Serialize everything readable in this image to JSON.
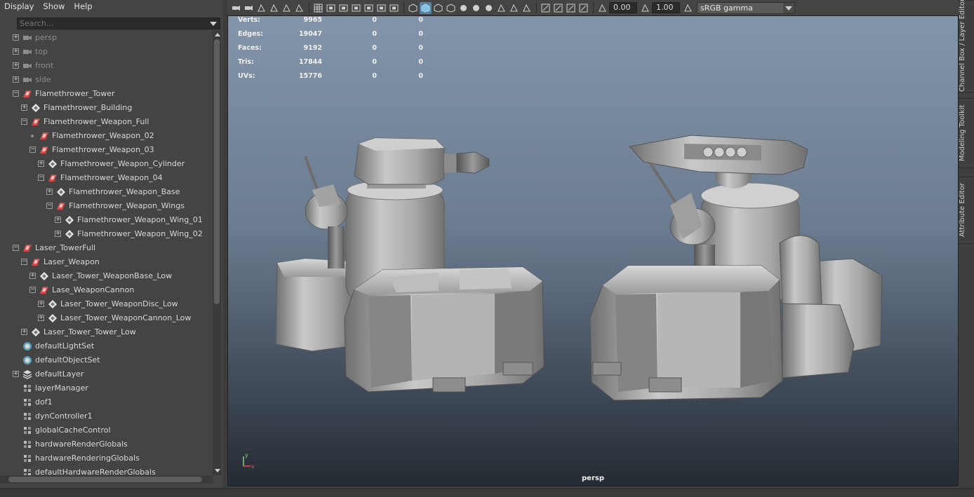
{
  "menu": [
    "Display",
    "Show",
    "Help"
  ],
  "search": {
    "placeholder": "Search..."
  },
  "outliner": [
    {
      "label": "persp",
      "type": "camera",
      "depth": 0,
      "expander": "plus",
      "dim": true
    },
    {
      "label": "top",
      "type": "camera",
      "depth": 0,
      "expander": "plus",
      "dim": true
    },
    {
      "label": "front",
      "type": "camera",
      "depth": 0,
      "expander": "plus",
      "dim": true
    },
    {
      "label": "side",
      "type": "camera",
      "depth": 0,
      "expander": "plus",
      "dim": true
    },
    {
      "label": "Flamethrower_Tower",
      "type": "group",
      "depth": 0,
      "expander": "minus"
    },
    {
      "label": "Flamethrower_Building",
      "type": "mesh",
      "depth": 1,
      "expander": "plus"
    },
    {
      "label": "Flamethrower_Weapon_Full",
      "type": "group",
      "depth": 1,
      "expander": "minus"
    },
    {
      "label": "Flamethrower_Weapon_02",
      "type": "group",
      "depth": 2,
      "expander": "dot"
    },
    {
      "label": "Flamethrower_Weapon_03",
      "type": "group",
      "depth": 2,
      "expander": "minus"
    },
    {
      "label": "Flamethrower_Weapon_Cylinder",
      "type": "mesh",
      "depth": 3,
      "expander": "plus"
    },
    {
      "label": "Flamethrower_Weapon_04",
      "type": "group",
      "depth": 3,
      "expander": "minus"
    },
    {
      "label": "Flamethrower_Weapon_Base",
      "type": "mesh",
      "depth": 4,
      "expander": "plus"
    },
    {
      "label": "Flamethrower_Weapon_Wings",
      "type": "group",
      "depth": 4,
      "expander": "minus"
    },
    {
      "label": "Flamethrower_Weapon_Wing_01",
      "type": "mesh",
      "depth": 5,
      "expander": "plus"
    },
    {
      "label": "Flamethrower_Weapon_Wing_02",
      "type": "mesh",
      "depth": 5,
      "expander": "plus"
    },
    {
      "label": "Laser_TowerFull",
      "type": "group",
      "depth": 0,
      "expander": "minus"
    },
    {
      "label": "Laser_Weapon",
      "type": "group",
      "depth": 1,
      "expander": "minus"
    },
    {
      "label": "Laser_Tower_WeaponBase_Low",
      "type": "mesh",
      "depth": 2,
      "expander": "plus"
    },
    {
      "label": "Lase_WeaponCannon",
      "type": "group",
      "depth": 2,
      "expander": "minus"
    },
    {
      "label": "Laser_Tower_WeaponDisc_Low",
      "type": "mesh",
      "depth": 3,
      "expander": "plus"
    },
    {
      "label": "Laser_Tower_WeaponCannon_Low",
      "type": "mesh",
      "depth": 3,
      "expander": "plus"
    },
    {
      "label": "Laser_Tower_Tower_Low",
      "type": "mesh",
      "depth": 1,
      "expander": "plus"
    },
    {
      "label": "defaultLightSet",
      "type": "set",
      "depth": 0,
      "expander": "none"
    },
    {
      "label": "defaultObjectSet",
      "type": "set",
      "depth": 0,
      "expander": "none"
    },
    {
      "label": "defaultLayer",
      "type": "layer",
      "depth": 0,
      "expander": "plus"
    },
    {
      "label": "layerManager",
      "type": "node",
      "depth": 0,
      "expander": "none"
    },
    {
      "label": "dof1",
      "type": "node",
      "depth": 0,
      "expander": "none"
    },
    {
      "label": "dynController1",
      "type": "node",
      "depth": 0,
      "expander": "none"
    },
    {
      "label": "globalCacheControl",
      "type": "node",
      "depth": 0,
      "expander": "none"
    },
    {
      "label": "hardwareRenderGlobals",
      "type": "node",
      "depth": 0,
      "expander": "none"
    },
    {
      "label": "hardwareRenderingGlobals",
      "type": "node",
      "depth": 0,
      "expander": "none"
    },
    {
      "label": "defaultHardwareRenderGlobals",
      "type": "node",
      "depth": 0,
      "expander": "none"
    }
  ],
  "toolbar": {
    "exposure": "0.00",
    "gamma": "1.00",
    "colorspace": "sRGB gamma",
    "icons": [
      "camera-select-icon",
      "camera-attr-icon",
      "bookmark-icon",
      "image-plane-icon",
      "2d-pan-zoom-icon",
      "grease-pencil-icon",
      "grid-icon",
      "film-gate-icon",
      "resolution-gate-icon",
      "gate-mask-icon",
      "field-chart-icon",
      "safe-action-icon",
      "safe-title-icon",
      "wireframe-icon",
      "smooth-shade-icon",
      "wire-on-shaded-icon",
      "textured-icon",
      "use-lights-icon",
      "shadows-icon",
      "ambient-occlusion-icon",
      "motion-blur-icon",
      "anti-alias-icon",
      "dof-icon",
      "isolate-icon",
      "xray-icon",
      "xray-joints-icon",
      "xray-components-icon",
      "exposure-icon",
      "gamma-icon",
      "color-management-icon"
    ]
  },
  "hud": [
    {
      "label": "Verts:",
      "v": "9965",
      "a": "0",
      "b": "0"
    },
    {
      "label": "Edges:",
      "v": "19047",
      "a": "0",
      "b": "0"
    },
    {
      "label": "Faces:",
      "v": "9192",
      "a": "0",
      "b": "0"
    },
    {
      "label": "Tris:",
      "v": "17844",
      "a": "0",
      "b": "0"
    },
    {
      "label": "UVs:",
      "v": "15776",
      "a": "0",
      "b": "0"
    }
  ],
  "camera_label": "persp",
  "axis": {
    "x": "x",
    "y": "y"
  },
  "side_tabs": [
    "Channel Box / Layer Editor",
    "Modeling Toolkit",
    "Attribute Editor"
  ]
}
